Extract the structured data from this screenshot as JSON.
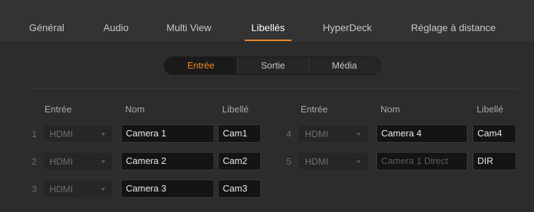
{
  "tabs": [
    {
      "label": "Général"
    },
    {
      "label": "Audio"
    },
    {
      "label": "Multi View"
    },
    {
      "label": "Libellés",
      "active": true
    },
    {
      "label": "HyperDeck"
    },
    {
      "label": "Réglage à distance"
    }
  ],
  "segment": {
    "options": [
      "Entrée",
      "Sortie",
      "Média"
    ],
    "selected": "Entrée"
  },
  "columns": {
    "left": {
      "entree": "Entrée",
      "nom": "Nom",
      "libelle": "Libellé"
    },
    "right": {
      "entree": "Entrée",
      "nom": "Nom",
      "libelle": "Libellé"
    }
  },
  "rows": [
    {
      "num": "1",
      "input": "HDMI",
      "name": "Camera 1",
      "label": "Cam1"
    },
    {
      "num": "2",
      "input": "HDMI",
      "name": "Camera 2",
      "label": "Cam2"
    },
    {
      "num": "3",
      "input": "HDMI",
      "name": "Camera 3",
      "label": "Cam3"
    },
    {
      "num": "4",
      "input": "HDMI",
      "name": "Camera 4",
      "label": "Cam4"
    },
    {
      "num": "5",
      "input": "HDMI",
      "name_placeholder": "Camera 1 Direct",
      "label": "DIR"
    }
  ],
  "colors": {
    "accent": "#f08a24",
    "background": "#2c2c2c",
    "tabbar": "#333333",
    "field": "#141414"
  }
}
